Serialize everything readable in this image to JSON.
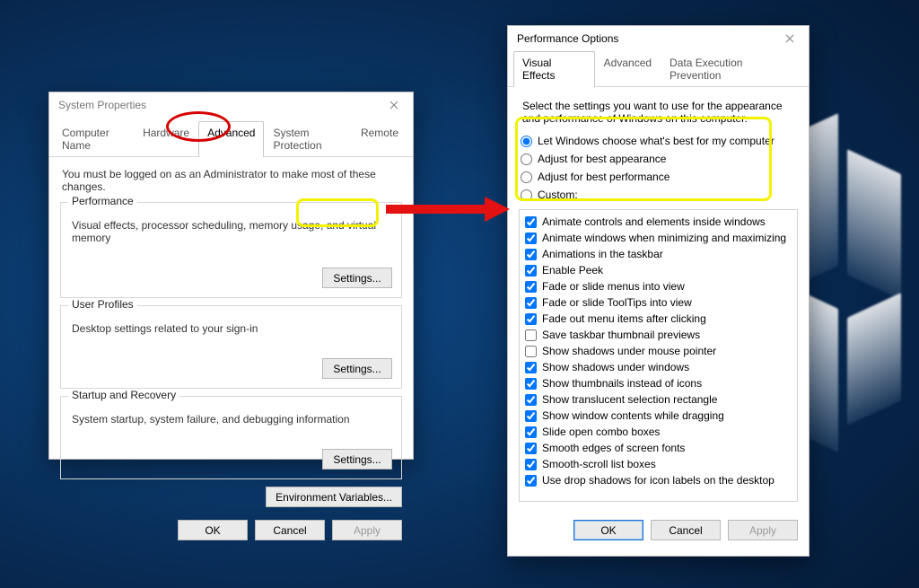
{
  "sp": {
    "title": "System Properties",
    "tabs": [
      "Computer Name",
      "Hardware",
      "Advanced",
      "System Protection",
      "Remote"
    ],
    "active_tab_index": 2,
    "admin_note": "You must be logged on as an Administrator to make most of these changes.",
    "groups": {
      "performance": {
        "label": "Performance",
        "desc": "Visual effects, processor scheduling, memory usage, and virtual memory",
        "button": "Settings..."
      },
      "user_profiles": {
        "label": "User Profiles",
        "desc": "Desktop settings related to your sign-in",
        "button": "Settings..."
      },
      "startup": {
        "label": "Startup and Recovery",
        "desc": "System startup, system failure, and debugging information",
        "button": "Settings..."
      }
    },
    "env_button": "Environment Variables...",
    "buttons": {
      "ok": "OK",
      "cancel": "Cancel",
      "apply": "Apply"
    }
  },
  "po": {
    "title": "Performance Options",
    "tabs": [
      "Visual Effects",
      "Advanced",
      "Data Execution Prevention"
    ],
    "active_tab_index": 0,
    "intro": "Select the settings you want to use for the appearance and performance of Windows on this computer.",
    "radios": [
      {
        "label": "Let Windows choose what's best for my computer",
        "checked": true
      },
      {
        "label": "Adjust for best appearance",
        "checked": false
      },
      {
        "label": "Adjust for best performance",
        "checked": false
      },
      {
        "label": "Custom:",
        "checked": false
      }
    ],
    "options": [
      {
        "label": "Animate controls and elements inside windows",
        "checked": true
      },
      {
        "label": "Animate windows when minimizing and maximizing",
        "checked": true
      },
      {
        "label": "Animations in the taskbar",
        "checked": true
      },
      {
        "label": "Enable Peek",
        "checked": true
      },
      {
        "label": "Fade or slide menus into view",
        "checked": true
      },
      {
        "label": "Fade or slide ToolTips into view",
        "checked": true
      },
      {
        "label": "Fade out menu items after clicking",
        "checked": true
      },
      {
        "label": "Save taskbar thumbnail previews",
        "checked": false
      },
      {
        "label": "Show shadows under mouse pointer",
        "checked": false
      },
      {
        "label": "Show shadows under windows",
        "checked": true
      },
      {
        "label": "Show thumbnails instead of icons",
        "checked": true
      },
      {
        "label": "Show translucent selection rectangle",
        "checked": true
      },
      {
        "label": "Show window contents while dragging",
        "checked": true
      },
      {
        "label": "Slide open combo boxes",
        "checked": true
      },
      {
        "label": "Smooth edges of screen fonts",
        "checked": true
      },
      {
        "label": "Smooth-scroll list boxes",
        "checked": true
      },
      {
        "label": "Use drop shadows for icon labels on the desktop",
        "checked": true
      }
    ],
    "buttons": {
      "ok": "OK",
      "cancel": "Cancel",
      "apply": "Apply"
    }
  }
}
